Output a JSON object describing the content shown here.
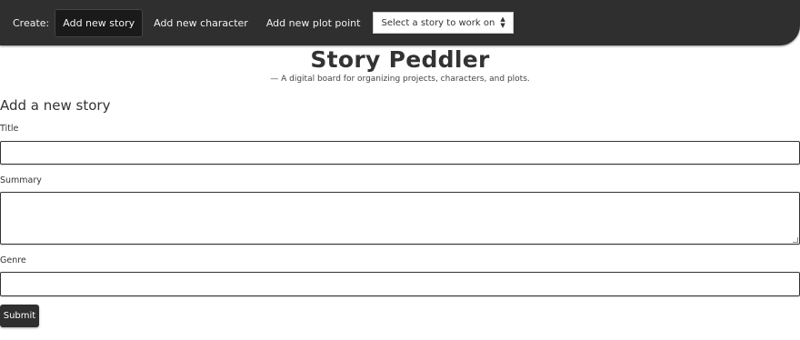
{
  "nav": {
    "create_label": "Create:",
    "items": [
      {
        "label": "Add new story",
        "active": true
      },
      {
        "label": "Add new character",
        "active": false
      },
      {
        "label": "Add new plot point",
        "active": false
      }
    ],
    "story_select": {
      "selected": "Select a story to work on"
    }
  },
  "header": {
    "title": "Story Peddler",
    "tagline": "— A digital board for organizing projects, characters, and plots."
  },
  "form": {
    "heading": "Add a new story",
    "title_label": "Title",
    "title_value": "",
    "summary_label": "Summary",
    "summary_value": "",
    "genre_label": "Genre",
    "genre_value": "",
    "submit_label": "Submit"
  },
  "colors": {
    "navbar_bg": "#2f2f2f",
    "active_item_bg": "#1a1a1a",
    "submit_bg": "#2f2f2f"
  }
}
